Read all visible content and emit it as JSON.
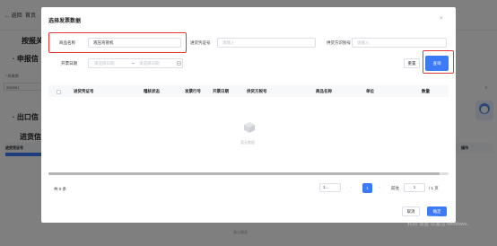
{
  "background": {
    "back_label": "← 返回",
    "tab_label": "首页",
    "heading": "按报关",
    "section1": "· 申报信",
    "field_label": "* 所属期",
    "field_value": "2023/01",
    "section2": "· 出口信",
    "subheading": "进货信",
    "table_col_first": "进货凭证号",
    "table_col_last": "操作",
    "footer_text": "浙江税务",
    "dropdown_chevron": "∨"
  },
  "modal": {
    "title": "选择发票数据",
    "close_icon": "×",
    "filters": {
      "product_name_label": "商品名称",
      "product_name_value": "液压弯管机",
      "voucher_no_label": "进货凭证号",
      "voucher_no_placeholder": "请输入",
      "supplier_tax_label": "供货方识别号",
      "supplier_tax_placeholder": "请输入",
      "date_label": "开票日期",
      "date_start_placeholder": "请选择日期",
      "date_separator": "~",
      "date_end_placeholder": "请选择日期"
    },
    "buttons": {
      "reset": "重置",
      "query": "查询",
      "cancel": "取消",
      "confirm": "确定"
    },
    "table": {
      "columns": [
        "进货凭证号",
        "稽核状态",
        "发票行号",
        "开票日期",
        "供货方税号",
        "商品名称",
        "单位",
        "数量"
      ],
      "empty_text": "暂无数据"
    },
    "pagination": {
      "total_text": "共 0 条",
      "page_size": "1...",
      "prev": "‹",
      "current_page": "1",
      "next": "›",
      "goto_label": "前往",
      "goto_value": "1",
      "of_pages": "/ 1 页"
    }
  },
  "windows_watermark": {
    "line1": "激活 Windows",
    "line2": "转到\"设置\"以激活 Windows。"
  },
  "colors": {
    "primary": "#3c7bf5",
    "highlight": "#e53935",
    "overlay": "rgba(0,0,0,0.5)"
  }
}
